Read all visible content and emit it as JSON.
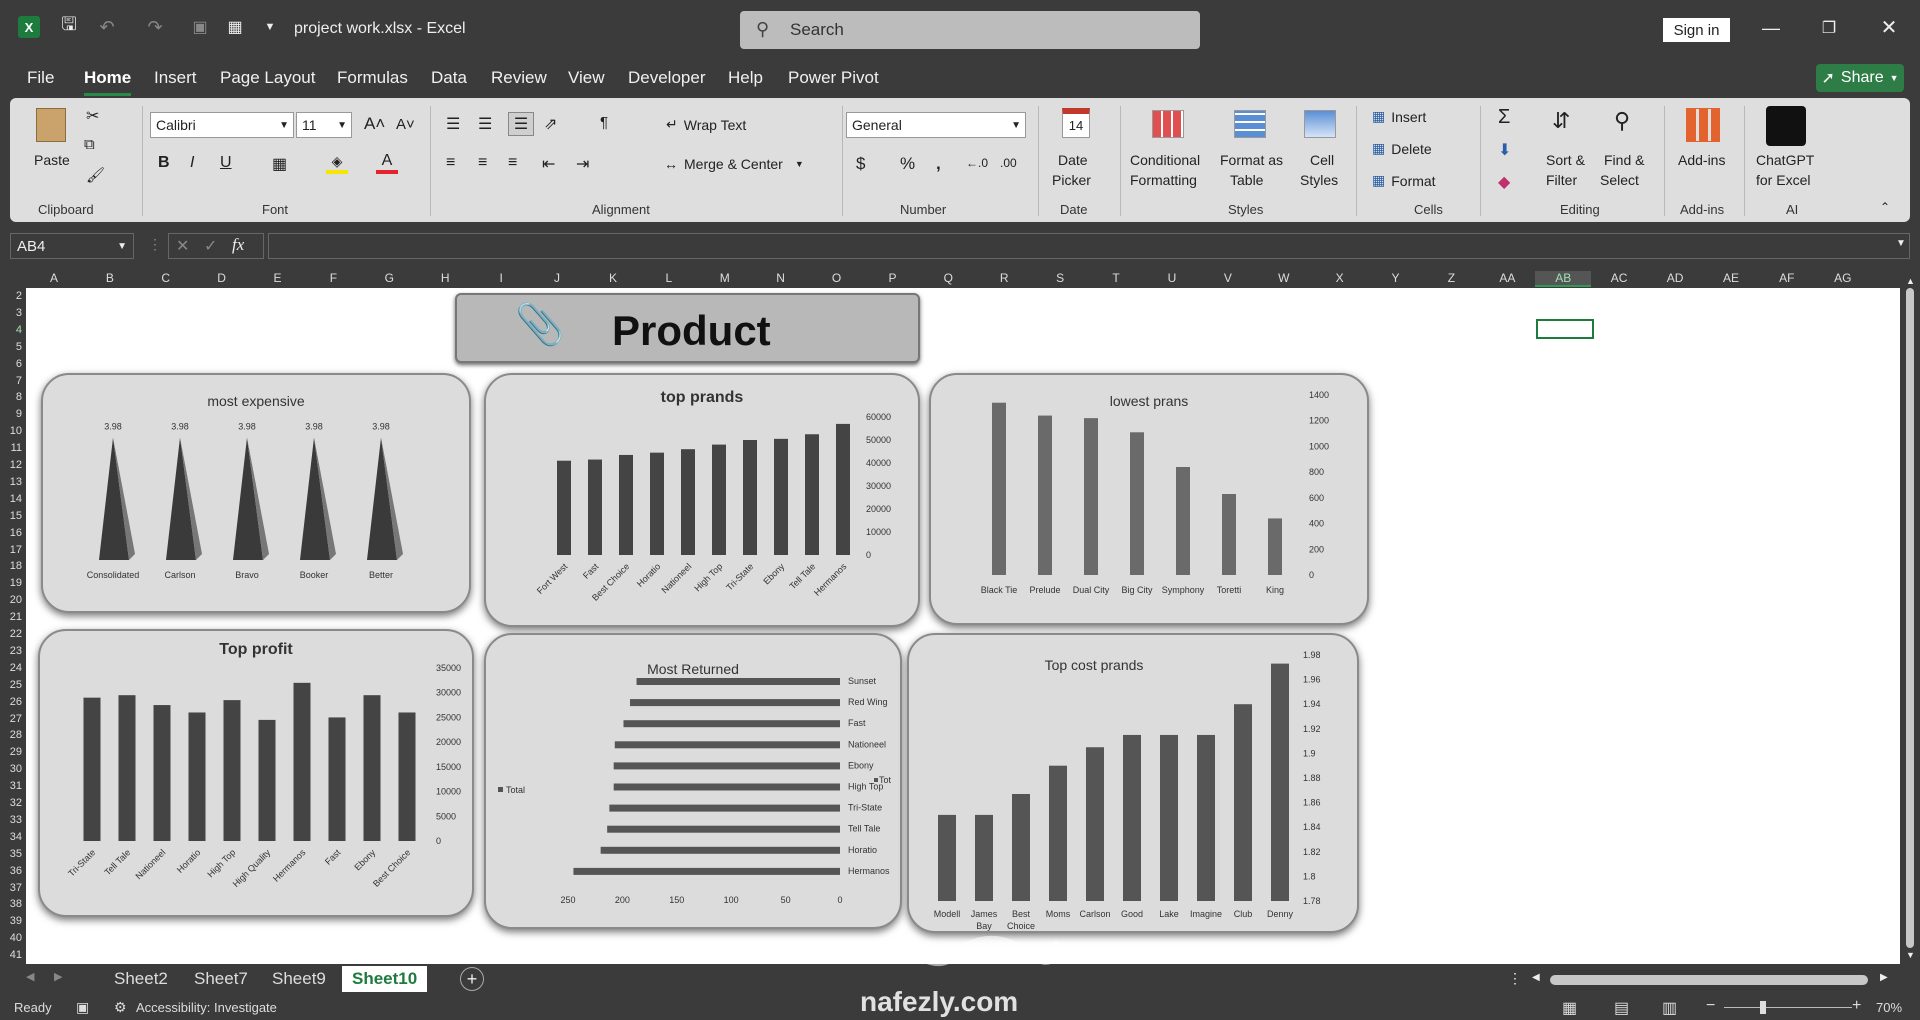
{
  "window": {
    "title": "project work.xlsx  -  Excel",
    "search_placeholder": "Search",
    "signin": "Sign in",
    "share": "Share"
  },
  "menu": [
    "File",
    "Home",
    "Insert",
    "Page Layout",
    "Formulas",
    "Data",
    "Review",
    "View",
    "Developer",
    "Help",
    "Power Pivot"
  ],
  "ribbon": {
    "clipboard": {
      "paste": "Paste",
      "label": "Clipboard"
    },
    "font": {
      "name": "Calibri",
      "size": "11",
      "label": "Font"
    },
    "alignment": {
      "wrap": "Wrap Text",
      "merge": "Merge & Center",
      "label": "Alignment"
    },
    "number": {
      "format": "General",
      "label": "Number"
    },
    "date": {
      "btn1": "Date",
      "btn2": "Picker",
      "label": "Date",
      "day": "14"
    },
    "styles": {
      "cond1": "Conditional",
      "cond2": "Formatting",
      "fmt1": "Format as",
      "fmt2": "Table",
      "cell1": "Cell",
      "cell2": "Styles",
      "label": "Styles"
    },
    "cells": {
      "insert": "Insert",
      "delete": "Delete",
      "format": "Format",
      "label": "Cells"
    },
    "editing": {
      "sort1": "Sort &",
      "sort2": "Filter",
      "find1": "Find &",
      "find2": "Select",
      "label": "Editing"
    },
    "addins": {
      "btn": "Add-ins",
      "label": "Add-ins"
    },
    "ai": {
      "btn1": "ChatGPT",
      "btn2": "for Excel",
      "label": "AI"
    }
  },
  "formula_bar": {
    "cell_ref": "AB4",
    "fx": "fx",
    "value": ""
  },
  "columns": [
    "A",
    "B",
    "C",
    "D",
    "E",
    "F",
    "G",
    "H",
    "I",
    "J",
    "K",
    "L",
    "M",
    "N",
    "O",
    "P",
    "Q",
    "R",
    "S",
    "T",
    "U",
    "V",
    "W",
    "X",
    "Y",
    "Z",
    "AA",
    "AB",
    "AC",
    "AD",
    "AE",
    "AF",
    "AG"
  ],
  "rows": [
    "2",
    "3",
    "4",
    "5",
    "6",
    "7",
    "8",
    "9",
    "10",
    "11",
    "12",
    "13",
    "14",
    "15",
    "16",
    "17",
    "18",
    "19",
    "20",
    "21",
    "22",
    "23",
    "24",
    "25",
    "26",
    "27",
    "28",
    "29",
    "30",
    "31",
    "32",
    "33",
    "34",
    "35",
    "36",
    "37",
    "38",
    "39",
    "40",
    "41"
  ],
  "dashboard_title": "Product",
  "chart_data": [
    {
      "type": "bar",
      "title": "most expensive",
      "categories": [
        "Consolidated",
        "Carlson",
        "Bravo",
        "Booker",
        "Better"
      ],
      "values": [
        3.98,
        3.98,
        3.98,
        3.98,
        3.98
      ],
      "data_labels": [
        "3.98",
        "3.98",
        "3.98",
        "3.98",
        "3.98"
      ]
    },
    {
      "type": "bar",
      "title": "top prands",
      "categories": [
        "Fort West",
        "Fast",
        "Best Choice",
        "Horatio",
        "Nationeel",
        "High Top",
        "Tri-State",
        "Ebony",
        "Tell Tale",
        "Hermanos"
      ],
      "values": [
        41000,
        41500,
        43500,
        44500,
        46000,
        48000,
        50000,
        50500,
        52500,
        57000
      ],
      "ylim": [
        0,
        60000
      ],
      "yticks": [
        "0",
        "10000",
        "20000",
        "30000",
        "40000",
        "50000",
        "60000"
      ]
    },
    {
      "type": "bar",
      "title": "lowest prans",
      "categories": [
        "Black Tie",
        "Prelude",
        "Dual City",
        "Big City",
        "Symphony",
        "Toretti",
        "King"
      ],
      "values": [
        1340,
        1240,
        1220,
        1110,
        840,
        630,
        440
      ],
      "ylim": [
        0,
        1400
      ],
      "yticks": [
        "0",
        "200",
        "400",
        "600",
        "800",
        "1000",
        "1200",
        "1400"
      ]
    },
    {
      "type": "bar",
      "title": "Top profit",
      "categories": [
        "Tri-State",
        "Tell Tale",
        "Nationeel",
        "Horatio",
        "High Top",
        "High Quality",
        "Hermanos",
        "Fast",
        "Ebony",
        "Best Choice"
      ],
      "values": [
        29000,
        29500,
        27500,
        26000,
        28500,
        24500,
        32000,
        25000,
        29500,
        26000
      ],
      "ylim": [
        0,
        35000
      ],
      "yticks": [
        "0",
        "5000",
        "10000",
        "15000",
        "20000",
        "25000",
        "30000",
        "35000"
      ]
    },
    {
      "type": "bar",
      "title": "Most Returned",
      "orientation": "horizontal",
      "categories": [
        "Sunset",
        "Red Wing",
        "Fast",
        "Nationeel",
        "Ebony",
        "High Top",
        "Tri-State",
        "Tell Tale",
        "Horatio",
        "Hermanos"
      ],
      "values": [
        187,
        193,
        199,
        207,
        208,
        208,
        212,
        214,
        220,
        245
      ],
      "xlim": [
        0,
        250
      ],
      "xticks": [
        "250",
        "200",
        "150",
        "100",
        "50",
        "0"
      ],
      "legend": "Total",
      "legend2": "Tot"
    },
    {
      "type": "bar",
      "title": "Top cost prands",
      "categories": [
        "Modell",
        "James Bay",
        "Best Choice",
        "Moms",
        "Carlson",
        "Good",
        "Lake",
        "Imagine",
        "Club",
        "Denny"
      ],
      "cat_lines": [
        [
          "Modell"
        ],
        [
          "James",
          "Bay"
        ],
        [
          "Best",
          "Choice"
        ],
        [
          "Moms"
        ],
        [
          "Carlson"
        ],
        [
          "Good"
        ],
        [
          "Lake"
        ],
        [
          "Imagine"
        ],
        [
          "Club"
        ],
        [
          "Denny"
        ]
      ],
      "values": [
        1.85,
        1.85,
        1.867,
        1.89,
        1.905,
        1.915,
        1.915,
        1.915,
        1.94,
        1.973
      ],
      "ylim": [
        1.78,
        1.98
      ],
      "yticks": [
        "1.78",
        "1.8",
        "1.82",
        "1.84",
        "1.86",
        "1.88",
        "1.9",
        "1.92",
        "1.94",
        "1.96",
        "1.98"
      ]
    }
  ],
  "sheets": [
    "Sheet2",
    "Sheet7",
    "Sheet9",
    "Sheet10"
  ],
  "status": {
    "ready": "Ready",
    "accessibility": "Accessibility: Investigate",
    "zoom": "70%"
  },
  "watermark": {
    "site": "nafezly.com"
  }
}
